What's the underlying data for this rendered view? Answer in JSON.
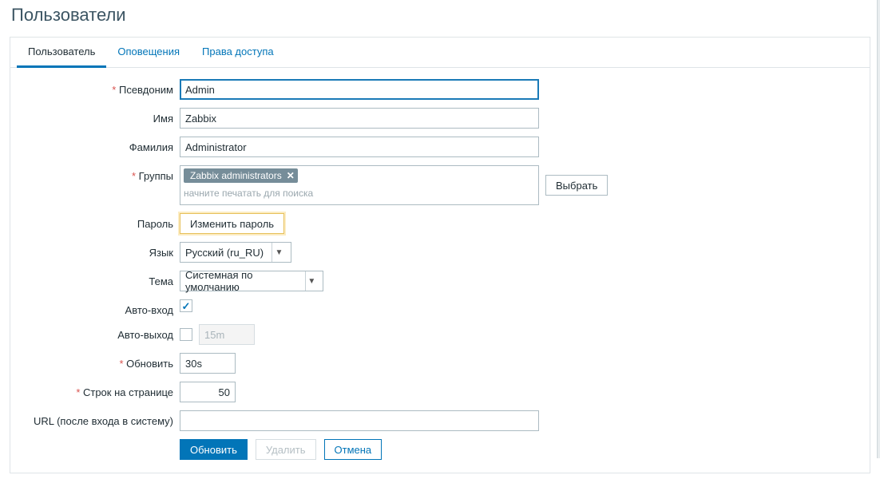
{
  "page_title": "Пользователи",
  "tabs": [
    {
      "label": "Пользователь",
      "active": true
    },
    {
      "label": "Оповещения",
      "active": false
    },
    {
      "label": "Права доступа",
      "active": false
    }
  ],
  "labels": {
    "alias": "Псевдоним",
    "name": "Имя",
    "surname": "Фамилия",
    "groups": "Группы",
    "password": "Пароль",
    "language": "Язык",
    "theme": "Тема",
    "autologin": "Авто-вход",
    "autologout": "Авто-выход",
    "refresh": "Обновить",
    "rows": "Строк на странице",
    "url": "URL (после входа в систему)"
  },
  "fields": {
    "alias": "Admin",
    "name": "Zabbix",
    "surname": "Administrator",
    "group_tag": "Zabbix administrators",
    "groups_hint": "начните печатать для поиска",
    "language_selected": "Русский (ru_RU)",
    "theme_selected": "Системная по умолчанию",
    "autologin_checked": true,
    "autologout_checked": false,
    "autologout_value": "15m",
    "refresh": "30s",
    "rows": "50",
    "url": ""
  },
  "buttons": {
    "select": "Выбрать",
    "change_password": "Изменить пароль",
    "update": "Обновить",
    "delete": "Удалить",
    "cancel": "Отмена"
  }
}
